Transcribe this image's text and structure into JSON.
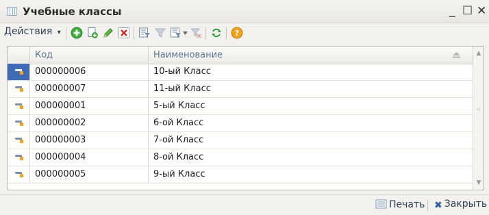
{
  "window": {
    "title": "Учебные классы",
    "minimize": "_",
    "maximize": "☐",
    "close": "✕"
  },
  "toolbar": {
    "actions_label": "Действия",
    "actions_arrow": "▾"
  },
  "table": {
    "columns": [
      "Код",
      "Наименование"
    ],
    "rows": [
      {
        "code": "000000006",
        "name": "10-ый Класс",
        "selected": true
      },
      {
        "code": "000000007",
        "name": "11-ый Класс"
      },
      {
        "code": "000000001",
        "name": "5-ый Класс"
      },
      {
        "code": "000000002",
        "name": "6-ой Класс"
      },
      {
        "code": "000000003",
        "name": "7-ой Класс"
      },
      {
        "code": "000000004",
        "name": "8-ой Класс"
      },
      {
        "code": "000000005",
        "name": "9-ый Класс"
      }
    ]
  },
  "scrollbar": {
    "up": "▲",
    "down": "▼"
  },
  "footer": {
    "print_label": "Печать",
    "close_label": "Закрыть"
  },
  "colors": {
    "selection": "#3f6bb5",
    "header_text": "#5f7290",
    "add_green": "#3fae3a",
    "help_orange": "#f0a11d",
    "close_x": "#2f5fa6"
  }
}
